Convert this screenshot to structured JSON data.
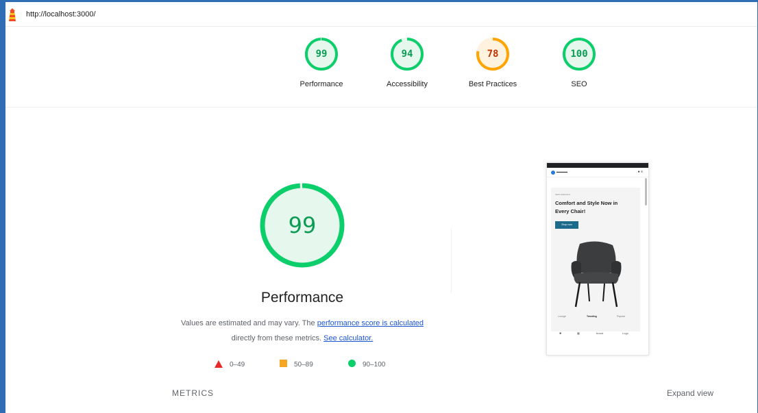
{
  "browser": {
    "url": "http://localhost:3000/"
  },
  "gauges": [
    {
      "label": "Performance",
      "score": "99",
      "level": 0.99,
      "color": "#0cce6b",
      "text_color": "#0c9d55",
      "fill": "#e6f7ee"
    },
    {
      "label": "Accessibility",
      "score": "94",
      "level": 0.94,
      "color": "#0cce6b",
      "text_color": "#0c9d55",
      "fill": "#e6f7ee"
    },
    {
      "label": "Best Practices",
      "score": "78",
      "level": 0.78,
      "color": "#ffa400",
      "text_color": "#c33300",
      "fill": "#fff3e0"
    },
    {
      "label": "SEO",
      "score": "100",
      "level": 1.0,
      "color": "#0cce6b",
      "text_color": "#0c9d55",
      "fill": "#e6f7ee"
    }
  ],
  "main": {
    "score": "99",
    "level": 0.99,
    "title": "Performance",
    "desc_prefix": "Values are estimated and may vary. The ",
    "link_score": "performance score is calculated",
    "desc_middle": " directly from these metrics. ",
    "link_calculator": "See calculator.",
    "legend": [
      {
        "shape": "triangle",
        "range": "0–49",
        "color": "#e62a2a"
      },
      {
        "shape": "square",
        "range": "50–89",
        "color": "#f5a623"
      },
      {
        "shape": "circle",
        "range": "90–100",
        "color": "#0cce6b"
      }
    ]
  },
  "screenshot": {
    "kicker": "NEW ARRIVALS",
    "headline": "Comfort and Style Now in Every Chair!",
    "button": "Shop now",
    "tabs": [
      "Lounge",
      "Trending",
      "Popular"
    ],
    "logos": [
      "✱",
      "▦",
      "brand",
      "Logo"
    ]
  },
  "footer": {
    "metrics_label": "METRICS",
    "expand_label": "Expand view"
  },
  "icons": {
    "logo": "lighthouse-icon",
    "legend": [
      "triangle-icon",
      "square-icon",
      "circle-icon"
    ]
  }
}
